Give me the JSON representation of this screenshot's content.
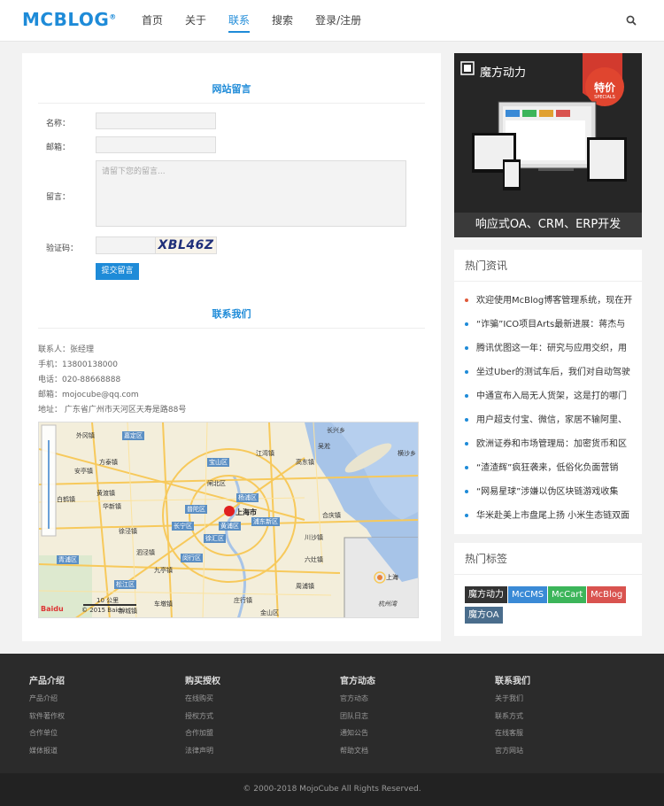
{
  "header": {
    "logo": "MCBLOG",
    "logo_mark": "®",
    "nav": [
      "首页",
      "关于",
      "联系",
      "搜索",
      "登录/注册"
    ]
  },
  "form": {
    "title": "网站留言",
    "name_label": "名称：",
    "email_label": "邮箱：",
    "message_label": "留言：",
    "message_placeholder": "请留下您的留言...",
    "captcha_label": "验证码：",
    "captcha_text": "XBL46Z",
    "submit": "提交留言"
  },
  "contact": {
    "title": "联系我们",
    "lines": [
      "联系人：张经理",
      "手机：13800138000",
      "电话：020-88668888",
      "邮箱：mojocube@qq.com",
      "地址：  广东省广州市天河区天寿是路88号"
    ]
  },
  "map": {
    "labels": [
      "外冈镇",
      "嘉定区",
      "安亭镇",
      "方泰镇",
      "宝山区",
      "江湾镇",
      "高东镇",
      "黄渡镇",
      "杨浦区",
      "华新镇",
      "白鹤镇",
      "徐泾镇",
      "闵行区",
      "上海市",
      "浦东新区",
      "九亭镇",
      "泗泾镇",
      "车墩镇",
      "青浦区",
      "吴淞",
      "长兴乡",
      "横沙乡",
      "川沙镇",
      "周浦镇",
      "闸北区",
      "金山区",
      "合庆镇",
      "六灶镇",
      "庄行镇",
      "新城镇",
      "松江区",
      "普陀区",
      "徐汇区",
      "长宁区",
      "黄浦区",
      "杭州湾"
    ],
    "scale": "10 公里",
    "brand": "Baidu",
    "copyright": "© 2015 Baidu",
    "city": "上海"
  },
  "ad": {
    "title": "魔方动力",
    "badge_top": "特价",
    "badge_sub": "SPECIALS",
    "bottom": "响应式OA、CRM、ERP开发"
  },
  "hot_news": {
    "title": "热门资讯",
    "items": [
      "欢迎使用McBlog博客管理系统，现在开",
      "“诈骗”ICO项目Arts最新进展：蒋杰与",
      "腾讯优图这一年：研究与应用交织，用",
      "坐过Uber的测试车后，我们对自动驾驶",
      "中通宣布入局无人货架，这是打的哪门",
      "用户超支付宝、微信，家居不输阿里、",
      "欧洲证券和市场管理局：加密货币和区",
      "“渣渣辉”疯狂袭来，低俗化负面营销",
      "“网易星球”涉嫌以伪区块链游戏收集",
      "华米赴美上市盘尾上扬 小米生态链双面"
    ]
  },
  "hot_tags": {
    "title": "热门标签",
    "tags": [
      {
        "label": "魔方动力",
        "color": "#333333"
      },
      {
        "label": "McCMS",
        "color": "#3a8ad6"
      },
      {
        "label": "McCart",
        "color": "#3cb55a"
      },
      {
        "label": "McBlog",
        "color": "#d9534f"
      },
      {
        "label": "魔方OA",
        "color": "#4a6d8c"
      }
    ]
  },
  "footer": {
    "columns": [
      {
        "title": "产品介绍",
        "items": [
          "产品介绍",
          "软件著作权",
          "合作单位",
          "媒体报道"
        ]
      },
      {
        "title": "购买授权",
        "items": [
          "在线购买",
          "授权方式",
          "合作加盟",
          "法律声明"
        ]
      },
      {
        "title": "官方动态",
        "items": [
          "官方动态",
          "团队日志",
          "通知公告",
          "帮助文档"
        ]
      },
      {
        "title": "联系我们",
        "items": [
          "关于我们",
          "联系方式",
          "在线客服",
          "官方网站"
        ]
      }
    ],
    "copyright": "© 2000-2018 MojoCube All Rights Reserved."
  },
  "colors": {
    "accent": "#1e8bd8",
    "footer_bg": "#2b2b2b"
  }
}
